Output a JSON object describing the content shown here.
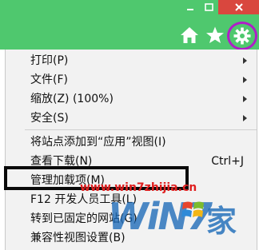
{
  "titlebar": {
    "color": "#4fc86e",
    "window_controls": [
      "minimize-icon",
      "maximize-icon",
      "close-icon"
    ],
    "nav_icons": [
      "home-icon",
      "favorites-star-icon",
      "tools-gear-icon"
    ]
  },
  "menu": {
    "items": [
      {
        "label": "打印(P)",
        "submenu": true
      },
      {
        "label": "文件(F)",
        "submenu": true
      },
      {
        "label": "缩放(Z) (100%)",
        "submenu": true
      },
      {
        "label": "安全(S)",
        "submenu": true
      },
      {
        "label": "将站点添加到“应用”视图(I)",
        "submenu": false
      },
      {
        "label": "查看下载(N)",
        "shortcut": "Ctrl+J",
        "submenu": false
      },
      {
        "label": "管理加载项(M)",
        "submenu": false,
        "highlighted": true
      },
      {
        "label": "F12 开发人员工具(L)",
        "submenu": false
      },
      {
        "label": "转到已固定的网站(G)",
        "submenu": false
      },
      {
        "label": "兼容性视图设置(B)",
        "submenu": false
      }
    ]
  },
  "watermark": {
    "url": "www.win7zhijia.cn",
    "logo": "WiN7",
    "home_char": "家",
    "colors": {
      "url": "#e02020",
      "logo": "#1b6ab8"
    }
  },
  "highlight_color": "#0a0a0a",
  "gear_ring_color": "#b01ec8"
}
